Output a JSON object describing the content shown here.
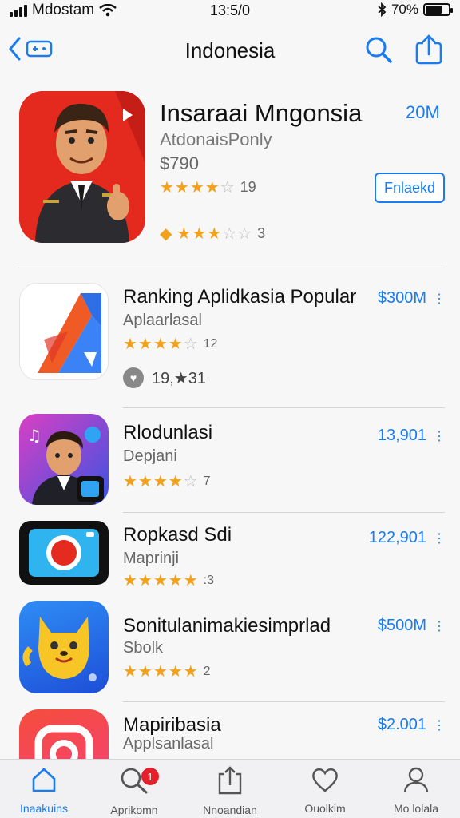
{
  "status_bar": {
    "carrier": "Mdostam",
    "time": "13:5/0",
    "battery_text": "70%",
    "battery_level": 0.7
  },
  "nav": {
    "title": "Indonesia"
  },
  "featured": {
    "name": "Insaraai Mngonsia",
    "size": "20M",
    "developer": "AtdonaisPonly",
    "price": "$790",
    "rating_count": "19",
    "rating2_count": "3",
    "button_label": "Fnlaekd",
    "rating": 3.5,
    "rating2": 3
  },
  "apps": [
    {
      "name": "Ranking Aplidkasia Popular",
      "sub": "Aplaarlasal",
      "rating": 3.5,
      "rating_count": "12",
      "price": "$300M",
      "extra": "19,★31"
    },
    {
      "name": "Rlodunlasi",
      "sub": "Depjani",
      "rating": 4,
      "rating_count": "7",
      "price": "13,901"
    },
    {
      "name": "Ropkasd Sdi",
      "sub": "Maprinji",
      "rating": 4.5,
      "rating_count": ":3",
      "price": "122,901"
    },
    {
      "name": "Sonitulanimakiesimprlad",
      "sub": "Sbolk",
      "rating": 4.5,
      "rating_count": "2",
      "price": "$500M"
    },
    {
      "name": "Mapiribasia",
      "sub": "Applsanlasal",
      "price": "$2.001"
    }
  ],
  "tabs": [
    {
      "label": "Inaakuins",
      "icon": "home-icon"
    },
    {
      "label": "Aprikomn",
      "icon": "search-icon",
      "badge": "1"
    },
    {
      "label": "Nnoandian",
      "icon": "share-icon"
    },
    {
      "label": "Ouolkim",
      "icon": "heart-icon"
    },
    {
      "label": "Mo lolala",
      "icon": "person-icon"
    }
  ],
  "colors": {
    "accent": "#1a7cf0",
    "star": "#f2a21a",
    "badge": "#e5202a"
  }
}
